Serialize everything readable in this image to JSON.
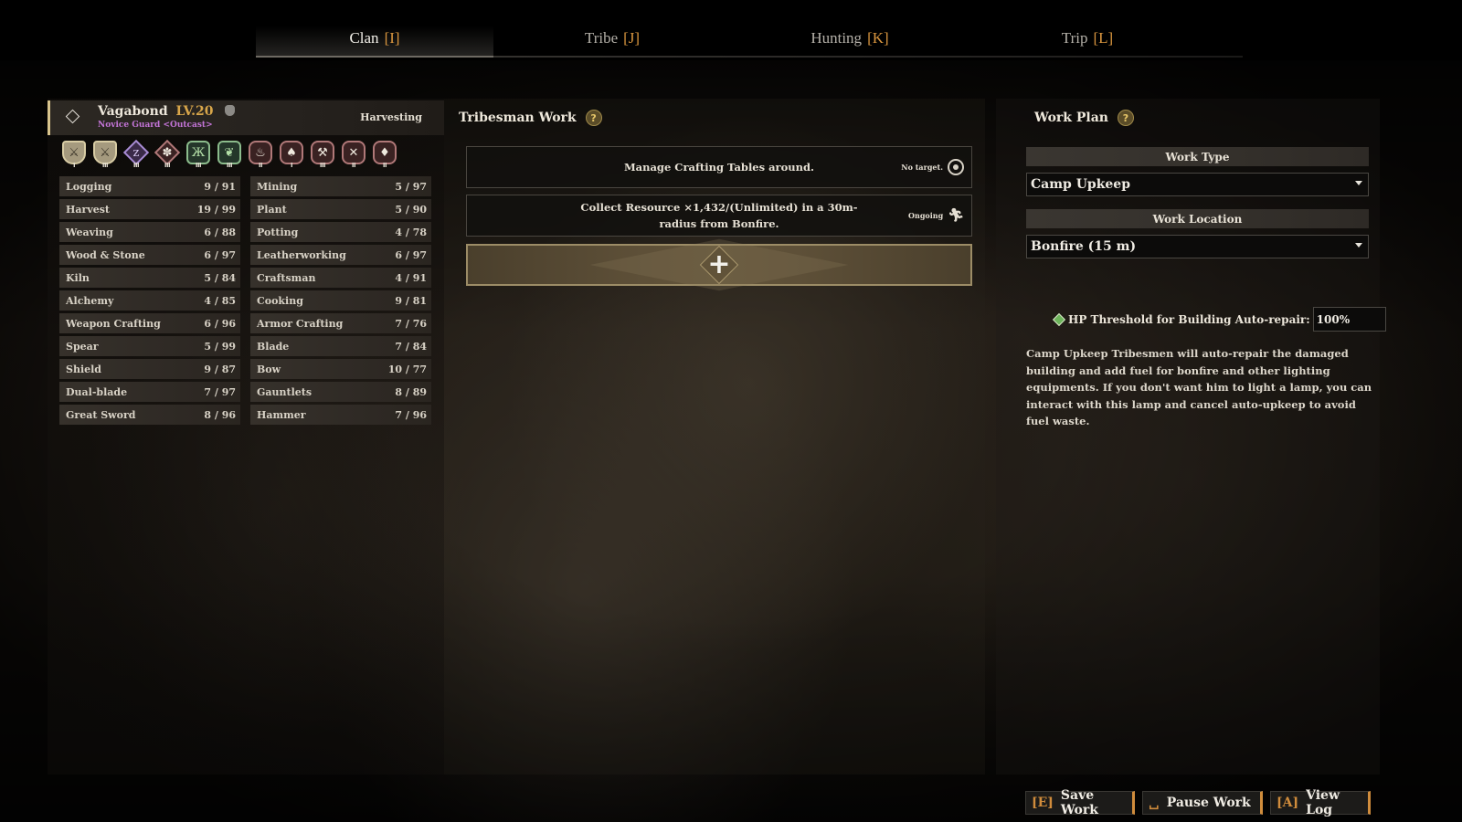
{
  "tabs": [
    {
      "label": "Clan",
      "key": "[I]",
      "active": true
    },
    {
      "label": "Tribe",
      "key": "[J]",
      "active": false
    },
    {
      "label": "Hunting",
      "key": "[K]",
      "active": false
    },
    {
      "label": "Trip",
      "key": "[L]",
      "active": false
    }
  ],
  "character": {
    "name": "Vagabond",
    "level": "LV.20",
    "title": "Novice Guard <Outcast>",
    "status": "Harvesting",
    "badges": [
      {
        "icon": "shield-sword-icon",
        "glyph": "⚔",
        "rank": "I"
      },
      {
        "icon": "shield-sword-icon",
        "glyph": "⚔",
        "rank": "III"
      },
      {
        "icon": "sleeping-person-icon",
        "glyph": "z",
        "rank": "III"
      },
      {
        "icon": "paw-icon",
        "glyph": "✽",
        "rank": "III"
      },
      {
        "icon": "grasp-icon",
        "glyph": "Ж",
        "rank": "III"
      },
      {
        "icon": "leaf-icon",
        "glyph": "❦",
        "rank": "III"
      },
      {
        "icon": "potion-icon",
        "glyph": "♨",
        "rank": "II"
      },
      {
        "icon": "meat-icon",
        "glyph": "♠",
        "rank": "I"
      },
      {
        "icon": "hammer-icon",
        "glyph": "⚒",
        "rank": "III"
      },
      {
        "icon": "crossed-swords-icon",
        "glyph": "✕",
        "rank": "II"
      },
      {
        "icon": "sword-upgrade-icon",
        "glyph": "♦",
        "rank": "II"
      }
    ]
  },
  "skills": [
    {
      "name": "Logging",
      "value": "9 / 91"
    },
    {
      "name": "Mining",
      "value": "5 / 97"
    },
    {
      "name": "Harvest",
      "value": "19 / 99"
    },
    {
      "name": "Plant",
      "value": "5 / 90"
    },
    {
      "name": "Weaving",
      "value": "6 / 88"
    },
    {
      "name": "Potting",
      "value": "4 / 78"
    },
    {
      "name": "Wood & Stone",
      "value": "6 / 97"
    },
    {
      "name": "Leatherworking",
      "value": "6 / 97"
    },
    {
      "name": "Kiln",
      "value": "5 / 84"
    },
    {
      "name": "Craftsman",
      "value": "4 / 91"
    },
    {
      "name": "Alchemy",
      "value": "4 / 85"
    },
    {
      "name": "Cooking",
      "value": "9 / 81"
    },
    {
      "name": "Weapon Crafting",
      "value": "6 / 96"
    },
    {
      "name": "Armor Crafting",
      "value": "7 / 76"
    },
    {
      "name": "Spear",
      "value": "5 / 99"
    },
    {
      "name": "Blade",
      "value": "7 / 84"
    },
    {
      "name": "Shield",
      "value": "9 / 87"
    },
    {
      "name": "Bow",
      "value": "10 / 77"
    },
    {
      "name": "Dual-blade",
      "value": "7 / 97"
    },
    {
      "name": "Gauntlets",
      "value": "8 / 89"
    },
    {
      "name": "Great Sword",
      "value": "8 / 96"
    },
    {
      "name": "Hammer",
      "value": "7 / 96"
    }
  ],
  "tribesman_work": {
    "title": "Tribesman Work",
    "help": "?",
    "tasks": [
      {
        "text": "Manage Crafting Tables around.",
        "status": "No target."
      },
      {
        "text": "Collect Resource ×1,432/(Unlimited) in a 30m-radius from Bonfire.",
        "status": "Ongoing"
      }
    ],
    "add_label": "+"
  },
  "work_plan": {
    "title": "Work Plan",
    "help": "?",
    "work_type_label": "Work Type",
    "work_type_value": "Camp Upkeep",
    "work_location_label": "Work Location",
    "work_location_value": "Bonfire (15 m)",
    "hp_threshold_label": "HP Threshold for Building Auto-repair:",
    "hp_threshold_value": "100%",
    "description": "Camp Upkeep Tribesmen will auto-repair the damaged building and add fuel for bonfire and other lighting equipments. If you don't want him to light a lamp, you can interact with this lamp and cancel auto-upkeep to avoid fuel waste."
  },
  "bottom_buttons": {
    "save": {
      "key": "[E]",
      "label": "Save Work"
    },
    "pause": {
      "key": "␣",
      "label": "Pause Work"
    },
    "log": {
      "key": "[A]",
      "label": "View Log"
    }
  },
  "colors": {
    "accent_orange": "#d08c3c",
    "level_gold": "#d8a64a",
    "title_purple": "#c274d6",
    "threshold_green": "#6cb45a"
  }
}
